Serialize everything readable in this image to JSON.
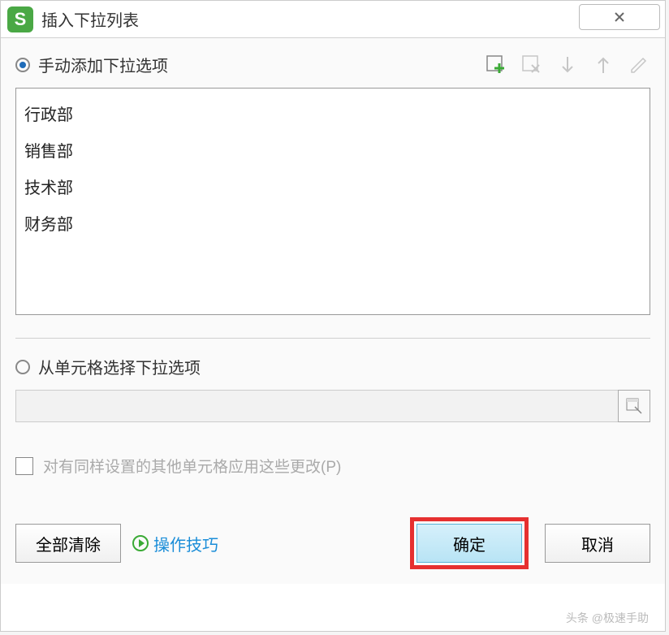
{
  "dialog": {
    "title": "插入下拉列表"
  },
  "options": {
    "manual": {
      "label": "手动添加下拉选项",
      "checked": true
    },
    "from_cells": {
      "label": "从单元格选择下拉选项",
      "checked": false,
      "input_value": ""
    }
  },
  "list_items": [
    "行政部",
    "销售部",
    "技术部",
    "财务部"
  ],
  "checkbox": {
    "label": "对有同样设置的其他单元格应用这些更改(P)",
    "checked": false
  },
  "buttons": {
    "clear_all": "全部清除",
    "tips": "操作技巧",
    "ok": "确定",
    "cancel": "取消"
  },
  "watermark": "头条 @极速手助"
}
